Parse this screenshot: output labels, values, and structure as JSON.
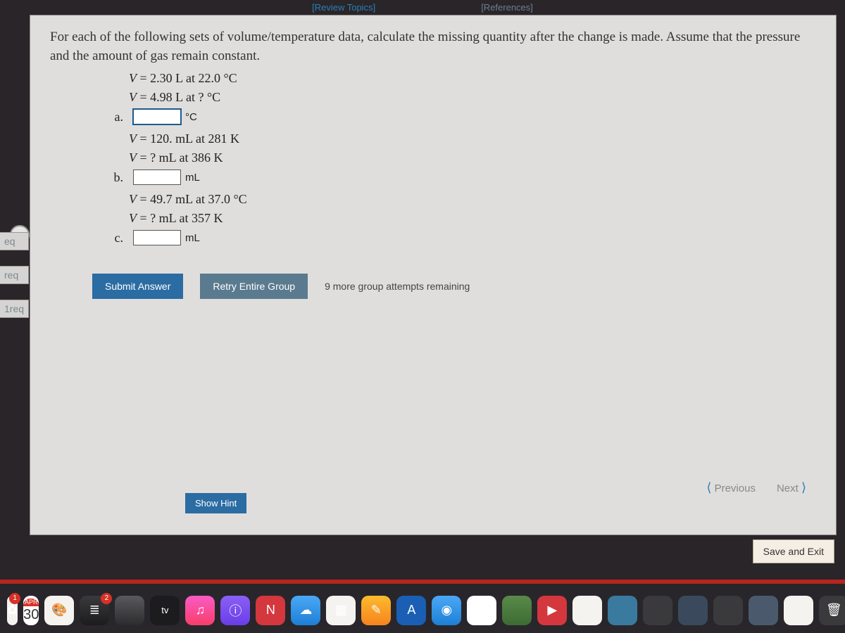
{
  "topLinks": {
    "review": "[Review Topics]",
    "references": "[References]"
  },
  "prompt": "For each of the following sets of volume/temperature data, calculate the missing quantity after the change is made. Assume that the pressure and the amount of gas remain constant.",
  "questions": {
    "a": {
      "label": "a.",
      "line1": "V = 2.30 L at 22.0 °C",
      "line2": "V = 4.98 L at ? °C",
      "unit": "°C",
      "value": ""
    },
    "b": {
      "label": "b.",
      "line1": "V = 120. mL at 281 K",
      "line2": "V = ? mL at 386 K",
      "unit": "mL",
      "value": ""
    },
    "c": {
      "label": "c.",
      "line1": "V = 49.7 mL at 37.0 °C",
      "line2": "V = ? mL at 357 K",
      "unit": "mL",
      "value": ""
    }
  },
  "buttons": {
    "submit": "Submit Answer",
    "retry": "Retry Entire Group",
    "showHint": "Show Hint",
    "saveExit": "Save and Exit"
  },
  "attemptsText": "9 more group attempts remaining",
  "nav": {
    "previous": "Previous",
    "next": "Next"
  },
  "leftTabs": [
    "eq",
    "req",
    "1req"
  ],
  "dock": {
    "calendar": {
      "month": "APR",
      "day": "30"
    },
    "photosBadge": "1",
    "remindersBadge": "2",
    "tvLabel": "tv",
    "icons": [
      {
        "bg": "#f5f3f0",
        "glyph": "🎨",
        "name": "photos-icon"
      },
      {
        "bg": "linear-gradient(#3a3a3c,#1c1c1e)",
        "glyph": "≣",
        "name": "reminders-icon"
      },
      {
        "bg": "linear-gradient(#5a5a5c,#2c2c2e)",
        "glyph": "",
        "name": "blank-icon"
      },
      {
        "bg": "#1c1c1e",
        "glyph": "",
        "name": "appletv-icon"
      },
      {
        "bg": "linear-gradient(#fb5bc5,#f83e6b)",
        "glyph": "♫",
        "name": "music-icon"
      },
      {
        "bg": "linear-gradient(#8a60f5,#6a3de8)",
        "glyph": "ⓘ",
        "name": "podcasts-icon"
      },
      {
        "bg": "#d4373d",
        "glyph": "N",
        "name": "news-icon"
      },
      {
        "bg": "linear-gradient(#4aa8f5,#1e7fd6)",
        "glyph": "☁",
        "name": "weather-icon"
      },
      {
        "bg": "#f5f3f0",
        "glyph": "▦",
        "name": "numbers-icon"
      },
      {
        "bg": "linear-gradient(#fdbb2d,#f5831f)",
        "glyph": "✎",
        "name": "pages-icon"
      },
      {
        "bg": "#1a5fb4",
        "glyph": "A",
        "name": "appstore-icon"
      },
      {
        "bg": "linear-gradient(#4aa8f5,#1e7fd6)",
        "glyph": "◉",
        "name": "safari-icon"
      },
      {
        "bg": "#fff",
        "glyph": "",
        "name": "chrome-icon"
      },
      {
        "bg": "linear-gradient(#5a8a4a,#3d6b33)",
        "glyph": "",
        "name": "facetime-icon"
      },
      {
        "bg": "#d4373d",
        "glyph": "▶",
        "name": "youtube-icon"
      },
      {
        "bg": "#f5f3f0",
        "glyph": "",
        "name": "finder-icon"
      },
      {
        "bg": "#3a7a9e",
        "glyph": "",
        "name": "gradescope-icon"
      },
      {
        "bg": "#3a3a3c",
        "glyph": "",
        "name": "terminal-icon"
      },
      {
        "bg": "#3a4a5c",
        "glyph": "",
        "name": "vscode-icon"
      },
      {
        "bg": "#3a3a3c",
        "glyph": "",
        "name": "settings-icon"
      },
      {
        "bg": "#4a5a6c",
        "glyph": "",
        "name": "xcode-icon"
      },
      {
        "bg": "#f5f3f0",
        "glyph": "",
        "name": "notes-icon"
      },
      {
        "bg": "#3a3a3c",
        "glyph": "🗑",
        "name": "trash-icon"
      }
    ]
  }
}
